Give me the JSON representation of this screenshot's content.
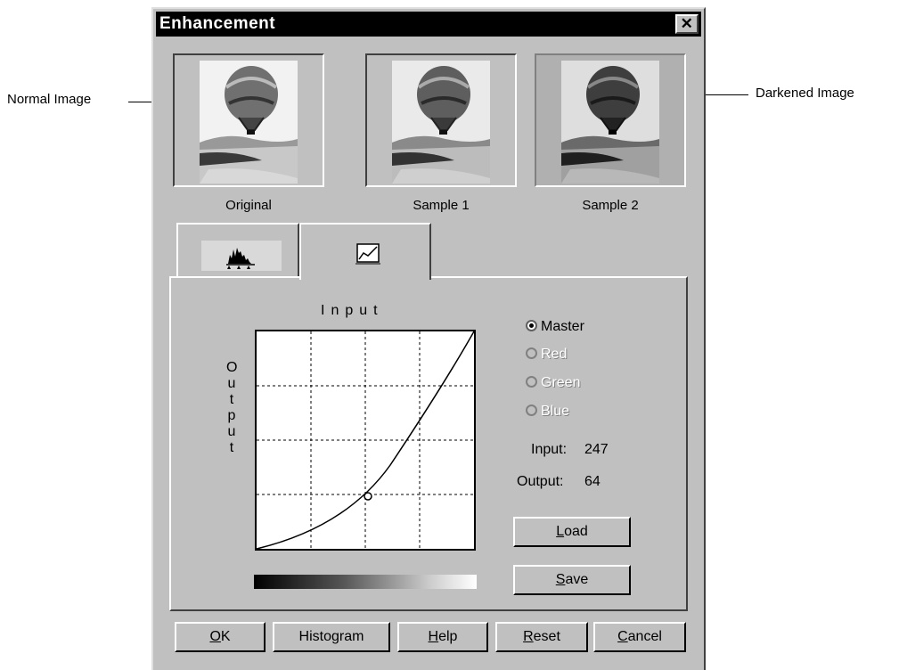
{
  "callouts": {
    "left": "Normal Image",
    "right": "Darkened Image"
  },
  "dialog": {
    "title": "Enhancement",
    "close_glyph": "✕"
  },
  "thumbnails": [
    {
      "label": "Original"
    },
    {
      "label": "Sample 1"
    },
    {
      "label": "Sample 2"
    }
  ],
  "tabs": [
    {
      "icon": "histogram-icon",
      "active": false
    },
    {
      "icon": "curve-icon",
      "active": true
    }
  ],
  "curve": {
    "input_axis_label": "Input",
    "output_axis_label": "Output",
    "selected_point": {
      "input": 247,
      "output": 64
    }
  },
  "channels": [
    {
      "label": "Master",
      "selected": true,
      "enabled": true
    },
    {
      "label": "Red",
      "selected": false,
      "enabled": false
    },
    {
      "label": "Green",
      "selected": false,
      "enabled": false
    },
    {
      "label": "Blue",
      "selected": false,
      "enabled": false
    }
  ],
  "readouts": {
    "input_label": "Input:",
    "input_value": "247",
    "output_label": "Output:",
    "output_value": "64"
  },
  "side_buttons": {
    "load": "Load",
    "load_key": "L",
    "save": "Save",
    "save_key": "S"
  },
  "footer_buttons": {
    "ok": "OK",
    "ok_key": "O",
    "histogram": "Histogram",
    "help": "Help",
    "help_key": "H",
    "reset": "Reset",
    "reset_key": "R",
    "cancel": "Cancel",
    "cancel_key": "C"
  }
}
